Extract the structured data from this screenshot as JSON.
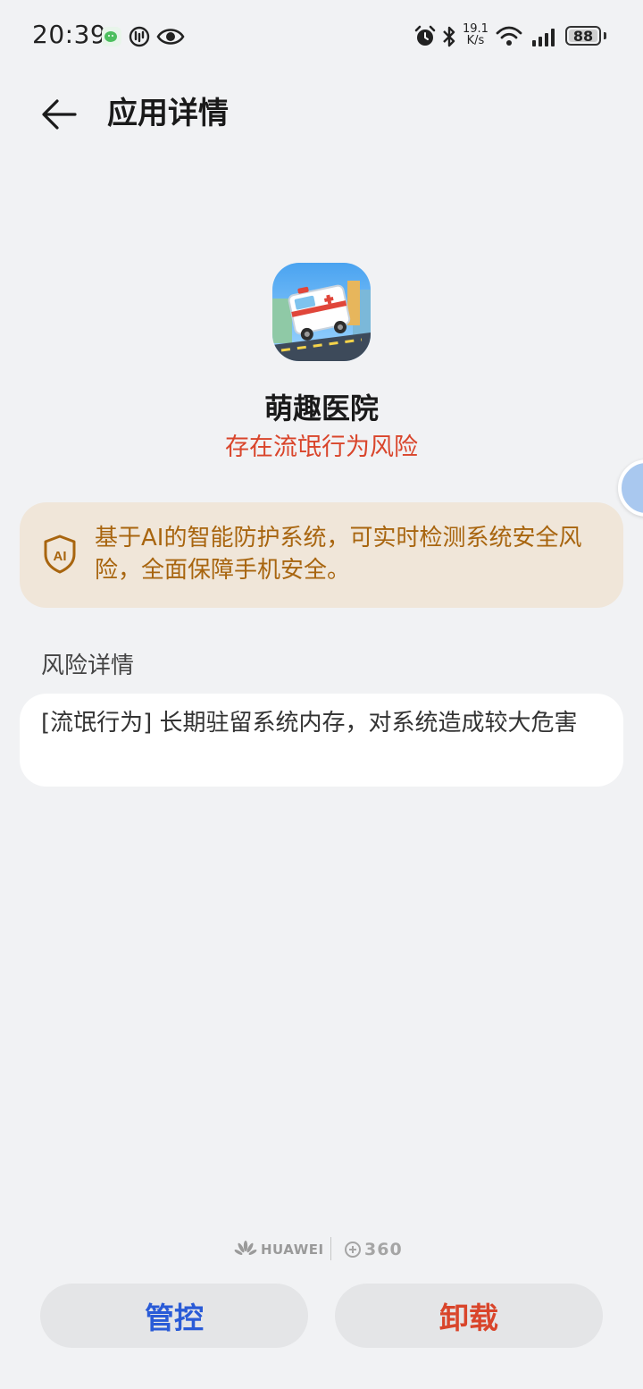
{
  "status_bar": {
    "time": "20:39",
    "net_speed_value": "19.1",
    "net_speed_unit": "K/s",
    "battery_level": "88"
  },
  "header": {
    "title": "应用详情"
  },
  "app": {
    "name": "萌趣医院",
    "risk_status": "存在流氓行为风险"
  },
  "protection_banner": {
    "icon_label": "AI",
    "text": "基于AI的智能防护系统，可实时检测系统安全风险，全面保障手机安全。"
  },
  "risk_details": {
    "section_title": "风险详情",
    "items": [
      "[流氓行为] 长期驻留系统内存，对系统造成较大危害"
    ]
  },
  "footer": {
    "brand_huawei": "HUAWEI",
    "brand_360": "360",
    "manage_label": "管控",
    "uninstall_label": "卸载"
  },
  "colors": {
    "background": "#f1f2f4",
    "risk_red": "#d9452b",
    "banner_bg": "#f0e6d9",
    "banner_text": "#a8650f",
    "manage_blue": "#2a5bd7"
  },
  "icons": [
    "wechat-icon",
    "app-icon",
    "eye-icon",
    "alarm-icon",
    "bluetooth-icon",
    "wifi-icon",
    "signal-icon",
    "battery-icon",
    "back-arrow-icon",
    "shield-ai-icon",
    "huawei-logo-icon",
    "360-logo-icon"
  ]
}
